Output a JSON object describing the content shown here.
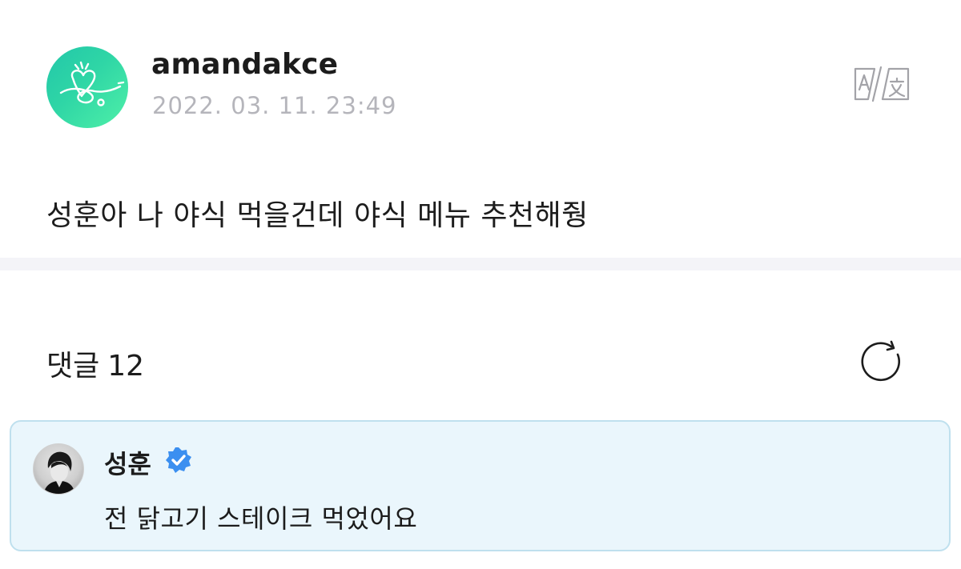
{
  "post": {
    "author": "amandakce",
    "timestamp": "2022. 03. 11. 23:49",
    "body": "성훈아 나 야식 먹을건데 야식 메뉴 추천해줭",
    "icons": {
      "avatar": "doodle-heart-avatar",
      "translate": "translate-icon"
    },
    "colors": {
      "avatar_gradient_start": "#22c7a9",
      "avatar_gradient_end": "#4ff0a8",
      "timestamp": "#b5b5bb"
    }
  },
  "comments": {
    "label": "댓글",
    "count": "12",
    "refresh_icon": "refresh-icon",
    "items": [
      {
        "author": "성훈",
        "verified": true,
        "verified_icon": "verified-badge-icon",
        "text": "전 닭고기 스테이크 먹었어요",
        "highlight_color": "#eaf6fc",
        "border_color": "#bfe0ee",
        "badge_color": "#3b8ff0"
      }
    ]
  }
}
